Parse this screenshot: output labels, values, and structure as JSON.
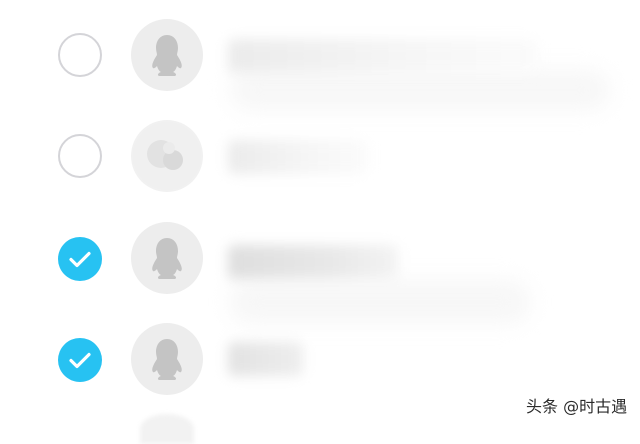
{
  "contacts": [
    {
      "name": "",
      "selected": false,
      "avatar": "penguin-avatar-icon"
    },
    {
      "name": "",
      "selected": false,
      "avatar": "custom-avatar-icon"
    },
    {
      "name": "",
      "selected": true,
      "avatar": "penguin-avatar-icon"
    },
    {
      "name": "",
      "selected": true,
      "avatar": "penguin-avatar-icon"
    }
  ],
  "colors": {
    "selected": "#27c2f2",
    "unselected_ring": "#d4d4d8",
    "avatar_bg": "#ededed",
    "avatar_glyph": "#c4c4c4"
  },
  "watermark": "头条 @时古遇"
}
